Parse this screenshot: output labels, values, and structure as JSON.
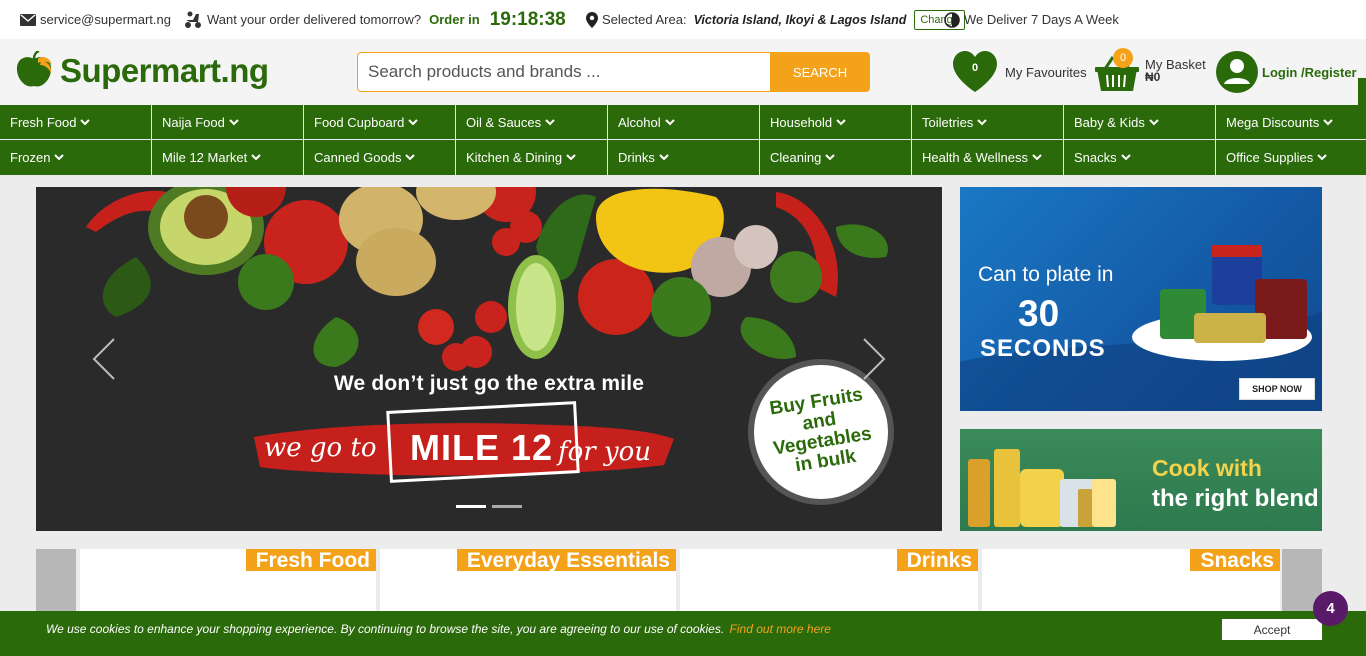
{
  "topbar": {
    "email": "service@supermart.ng",
    "delivery_question": "Want your order delivered tomorrow?",
    "order_in_label": "Order in",
    "timer": "19:18:38",
    "selected_area_label": "Selected Area:",
    "selected_area": "Victoria Island, Ikoyi & Lagos Island",
    "change_label": "Change",
    "deliver_days": "We Deliver 7 Days A Week"
  },
  "header": {
    "logo_text": "Supermart.ng",
    "search_placeholder": "Search products and brands ...",
    "search_button": "SEARCH",
    "favourites_label": "My Favourites",
    "favourites_count": "0",
    "basket_label": "My Basket",
    "basket_count": "0",
    "basket_amount": "₦0",
    "login_label": "Login /Register"
  },
  "nav": {
    "items": [
      "Fresh Food",
      "Naija Food",
      "Food Cupboard",
      "Oil & Sauces",
      "Alcohol",
      "Household",
      "Toiletries",
      "Baby & Kids",
      "Mega Discounts",
      "Frozen",
      "Mile 12 Market",
      "Canned Goods",
      "Kitchen & Dining",
      "Drinks",
      "Cleaning",
      "Health & Wellness",
      "Snacks",
      "Office Supplies"
    ]
  },
  "hero": {
    "headline": "We don’t just go the extra mile",
    "script_left": "we go to",
    "highlight": "MILE 12",
    "script_right": "for you",
    "badge_text": "Buy Fruits and Vegetables in bulk",
    "active_slide": 1,
    "slide_count": 2
  },
  "banners": {
    "b1_line1": "Can to plate in",
    "b1_number": "30",
    "b1_seconds": "SECONDS",
    "b1_cta": "SHOP NOW",
    "b2_line1": "Cook with",
    "b2_line2": "the right blend"
  },
  "categories": [
    {
      "label": "Fresh Food"
    },
    {
      "label": "Everyday Essentials"
    },
    {
      "label": "Drinks"
    },
    {
      "label": "Snacks"
    }
  ],
  "cookie": {
    "text": "We use cookies to enhance your shopping experience. By continuing to browse the site, you are agreeing to our use of cookies.",
    "link": "Find out more here",
    "accept": "Accept"
  },
  "chat_badge": "4",
  "colors": {
    "brand_green": "#2b6a0b",
    "accent_orange": "#f5a21b",
    "chat_purple": "#5a1a6a"
  }
}
